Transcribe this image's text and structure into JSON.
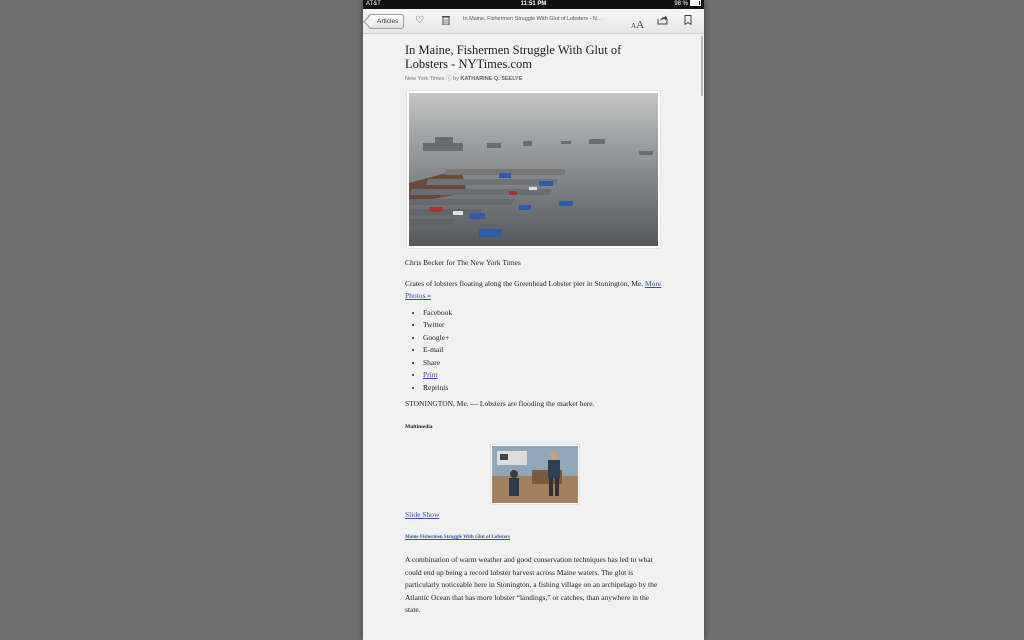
{
  "status_bar": {
    "carrier": "AT&T",
    "time": "11:51 PM",
    "battery": "98 %"
  },
  "toolbar": {
    "back_label": "Articles",
    "title": "In Maine, Fishermen Struggle With Glut of Lobsters - NYTimes.com",
    "icons": [
      "heart-icon",
      "trash-icon",
      "font-size-icon",
      "share-icon",
      "bookmark-icon"
    ]
  },
  "article": {
    "headline": "In Maine, Fishermen Struggle With Glut of Lobsters - NYTimes.com",
    "source": "New York Times",
    "by": "by",
    "author": "KATHARINE Q. SEELYE",
    "photo_credit": "Chris Becker for The New York Times",
    "caption_text": "Crates of lobsters floating along the Greenhead Lobster pier in Stonington, Me. ",
    "caption_link": "More Photos »",
    "share_items": [
      {
        "label": "Facebook",
        "link": false
      },
      {
        "label": "Twitter",
        "link": false
      },
      {
        "label": "Google+",
        "link": false
      },
      {
        "label": "E-mail",
        "link": false
      },
      {
        "label": "Share",
        "link": false
      },
      {
        "label": "Print",
        "link": true
      },
      {
        "label": "Reprints",
        "link": false
      }
    ],
    "dateline": "STONINGTON, Me. — Lobsters are flooding the market here.",
    "multimedia_label": "Multimedia",
    "slide_show_label": "Slide Show",
    "slide_show_title": "Maine Fishermen Struggle With Glut of Lobsters",
    "body": "A combination of warm weather and good conservation techniques has led to what could end up being a record lobster harvest across Maine waters. The glut is particularly noticeable here in Stonington, a fishing village on an archipelago by the Atlantic Ocean that has more lobster “landings,” or catches, than anywhere in the state."
  },
  "colors": {
    "background": "#6f6f6f",
    "page": "#f1f1f1",
    "link": "#3b4ea0"
  }
}
